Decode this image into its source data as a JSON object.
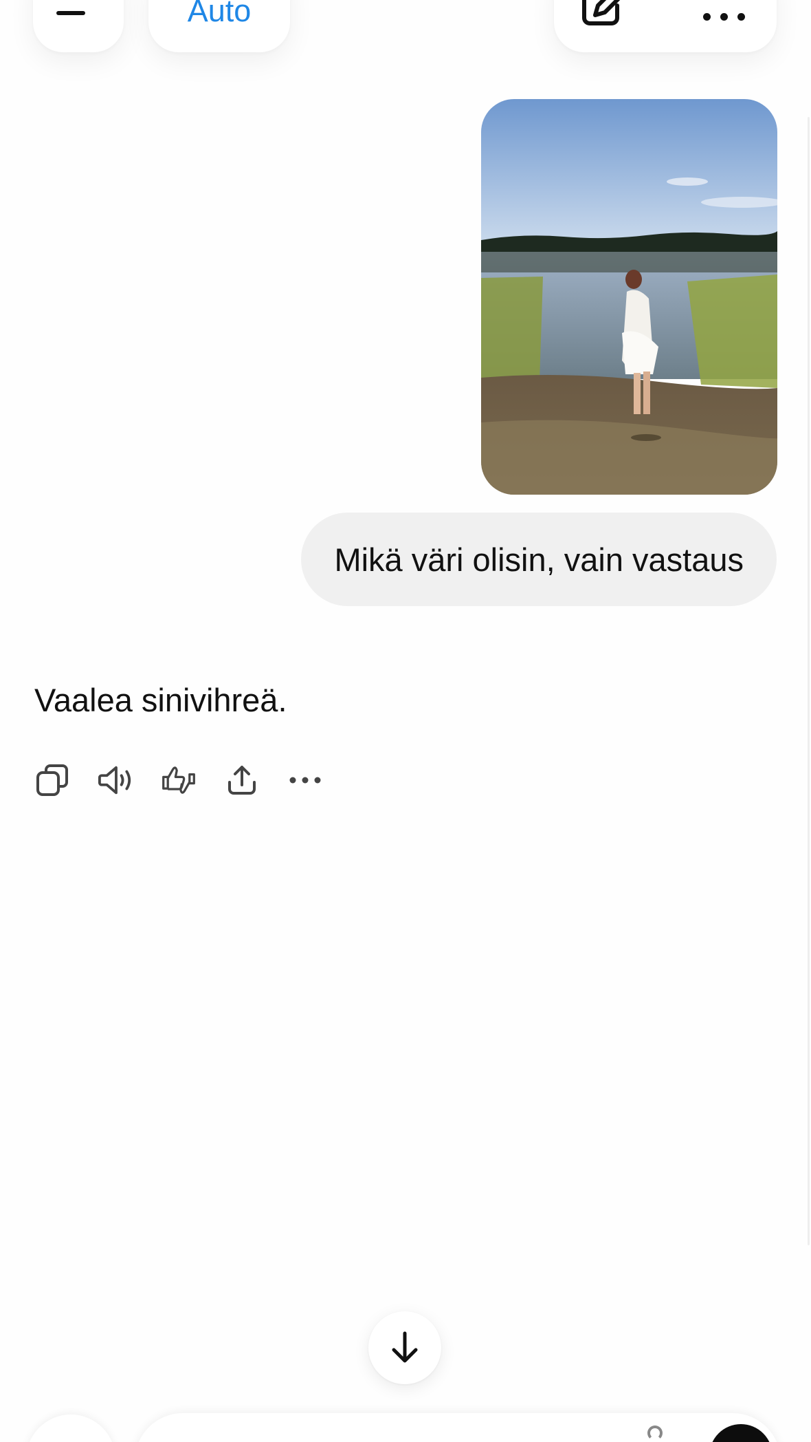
{
  "header": {
    "model_label": "Auto",
    "menu_icon": "menu-icon",
    "new_chat_icon": "edit-icon",
    "more_icon": "more-dots-icon"
  },
  "conversation": {
    "user_image": {
      "icon": "lake-photo-image"
    },
    "user_message": "Mikä väri olisin, vain vastaus",
    "assistant_message": "Vaalea sinivihreä.",
    "actions": [
      {
        "name": "copy",
        "icon": "copy-icon"
      },
      {
        "name": "read-aloud",
        "icon": "speaker-icon"
      },
      {
        "name": "feedback",
        "icon": "thumbs-icon"
      },
      {
        "name": "share",
        "icon": "share-icon"
      },
      {
        "name": "more",
        "icon": "more-dots-icon"
      }
    ]
  },
  "scroll_button": {
    "icon": "arrow-down-icon"
  },
  "colors": {
    "accent": "#1f87e6",
    "bubble": "#f0f0f0",
    "text": "#111111",
    "send": "#0d0d0d"
  }
}
